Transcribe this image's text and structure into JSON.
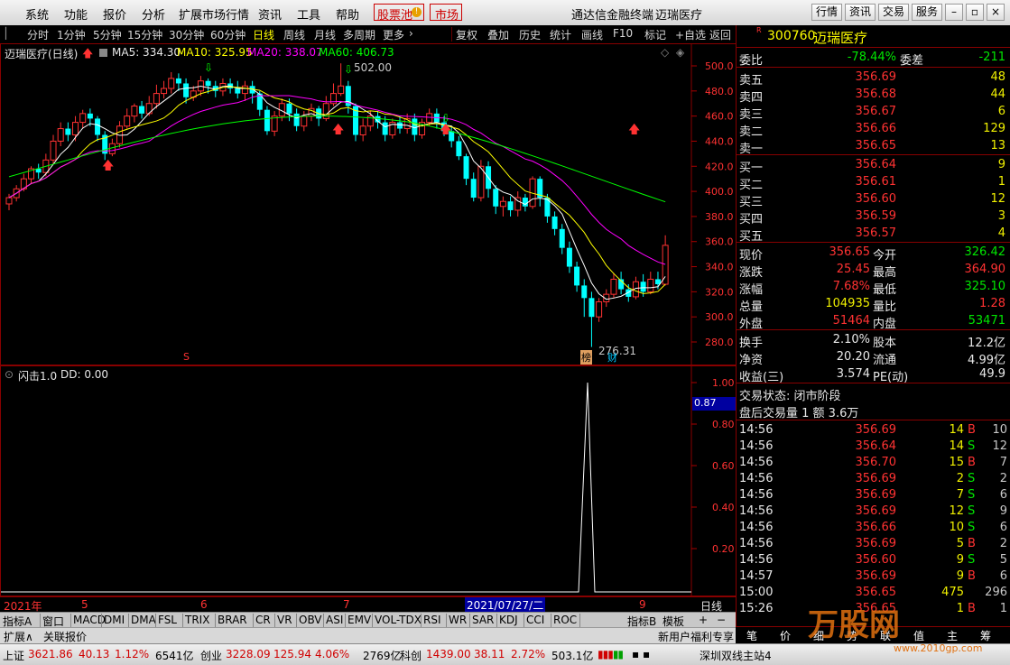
{
  "menu": {
    "items": [
      "系统",
      "功能",
      "报价",
      "分析",
      "扩展市场行情",
      "资讯",
      "工具",
      "帮助"
    ],
    "stock_pool": "股票池",
    "market": "市场",
    "app_title": "通达信金融终端",
    "stock_title": "迈瑞医疗",
    "right_buttons": [
      "行情",
      "资讯",
      "交易",
      "服务"
    ]
  },
  "toolbar": {
    "periods": [
      "分时",
      "1分钟",
      "5分钟",
      "15分钟",
      "30分钟",
      "60分钟",
      "日线",
      "周线",
      "月线",
      "多周期",
      "更多"
    ],
    "active": "日线",
    "tools": [
      "复权",
      "叠加",
      "历史",
      "统计",
      "画线",
      "F10",
      "标记",
      "+自选",
      "返回"
    ]
  },
  "chart": {
    "header": {
      "name": "迈瑞医疗(日线)",
      "ma5_label": "MA5: 334.30",
      "ma10_label": "MA10: 325.95",
      "ma20_label": "MA20: 338.07",
      "ma60_label": "MA60: 406.73"
    },
    "colors": {
      "up": "#ff3232",
      "down": "#00ffff",
      "ma5": "#ffffff",
      "ma10": "#ffff00",
      "ma20": "#ff00ff",
      "ma60": "#00ff00"
    },
    "yticks": [
      "500.0",
      "480.0",
      "460.0",
      "440.0",
      "420.0",
      "400.0",
      "380.0",
      "360.0",
      "340.0",
      "320.0",
      "300.0",
      "280.0"
    ],
    "high_marker": "502.00",
    "low_marker": "276.31",
    "badges": [
      "榜",
      "财"
    ],
    "s_marker": "S"
  },
  "indicator": {
    "name": "闪击1.0",
    "dd_label": "DD: 0.00",
    "yticks": [
      "1.00",
      "0.80",
      "0.60",
      "0.40",
      "0.20"
    ],
    "current": "0.87"
  },
  "xaxis": {
    "labels": [
      "2021年",
      "5",
      "6",
      "7",
      "9"
    ],
    "cursor": "2021/07/27/二",
    "period": "日线"
  },
  "indicator_tabs": [
    "指标A",
    "窗口",
    "MACD",
    "DMI",
    "DMA",
    "FSL",
    "TRIX",
    "BRAR",
    "CR",
    "VR",
    "OBV",
    "ASI",
    "EMV",
    "VOL-TDX",
    "RSI",
    "WR",
    "SAR",
    "KDJ",
    "CCI",
    "ROC"
  ],
  "indicator_tabs_right": [
    "指标B",
    "模",
    "板"
  ],
  "bottom_row": {
    "expand": "扩展∧",
    "link": "关联报价",
    "promo": "新用户福利专享"
  },
  "quote": {
    "code": "300760",
    "name": "迈瑞医疗",
    "weibi_label": "委比",
    "weibi": "-78.44%",
    "weicha_label": "委差",
    "weicha": "-211",
    "asks": [
      {
        "label": "卖五",
        "price": "356.69",
        "vol": "48"
      },
      {
        "label": "卖四",
        "price": "356.68",
        "vol": "44"
      },
      {
        "label": "卖三",
        "price": "356.67",
        "vol": "6"
      },
      {
        "label": "卖二",
        "price": "356.66",
        "vol": "129"
      },
      {
        "label": "卖一",
        "price": "356.65",
        "vol": "13"
      }
    ],
    "bids": [
      {
        "label": "买一",
        "price": "356.64",
        "vol": "9"
      },
      {
        "label": "买二",
        "price": "356.61",
        "vol": "1"
      },
      {
        "label": "买三",
        "price": "356.60",
        "vol": "12"
      },
      {
        "label": "买四",
        "price": "356.59",
        "vol": "3"
      },
      {
        "label": "买五",
        "price": "356.57",
        "vol": "4"
      }
    ],
    "stats": [
      {
        "l1": "现价",
        "v1": "356.65",
        "l2": "今开",
        "v2": "326.42",
        "c1": "c-red",
        "c2": "c-green"
      },
      {
        "l1": "涨跌",
        "v1": "25.45",
        "l2": "最高",
        "v2": "364.90",
        "c1": "c-red",
        "c2": "c-red"
      },
      {
        "l1": "涨幅",
        "v1": "7.68%",
        "l2": "最低",
        "v2": "325.10",
        "c1": "c-red",
        "c2": "c-green"
      },
      {
        "l1": "总量",
        "v1": "104935",
        "l2": "量比",
        "v2": "1.28",
        "c1": "c-yel",
        "c2": "c-red"
      },
      {
        "l1": "外盘",
        "v1": "51464",
        "l2": "内盘",
        "v2": "53471",
        "c1": "c-red",
        "c2": "c-green"
      }
    ],
    "stats2": [
      {
        "l1": "换手",
        "v1": "2.10%",
        "l2": "股本",
        "v2": "12.2亿"
      },
      {
        "l1": "净资",
        "v1": "20.20",
        "l2": "流通",
        "v2": "4.99亿"
      },
      {
        "l1": "收益(三)",
        "v1": "3.574",
        "l2": "PE(动)",
        "v2": "49.9"
      }
    ],
    "trade_status": "交易状态: 闭市阶段",
    "after_hours": "盘后交易量 1 额 3.6万",
    "ticks": [
      {
        "t": "14:56",
        "p": "356.69",
        "v": "14",
        "bs": "B",
        "n": "10"
      },
      {
        "t": "14:56",
        "p": "356.64",
        "v": "14",
        "bs": "S",
        "n": "12"
      },
      {
        "t": "14:56",
        "p": "356.70",
        "v": "15",
        "bs": "B",
        "n": "7"
      },
      {
        "t": "14:56",
        "p": "356.69",
        "v": "2",
        "bs": "S",
        "n": "2"
      },
      {
        "t": "14:56",
        "p": "356.69",
        "v": "7",
        "bs": "S",
        "n": "6"
      },
      {
        "t": "14:56",
        "p": "356.69",
        "v": "12",
        "bs": "S",
        "n": "9"
      },
      {
        "t": "14:56",
        "p": "356.66",
        "v": "10",
        "bs": "S",
        "n": "6"
      },
      {
        "t": "14:56",
        "p": "356.69",
        "v": "5",
        "bs": "B",
        "n": "2"
      },
      {
        "t": "14:56",
        "p": "356.60",
        "v": "9",
        "bs": "S",
        "n": "5"
      },
      {
        "t": "14:57",
        "p": "356.69",
        "v": "9",
        "bs": "B",
        "n": "6"
      },
      {
        "t": "15:00",
        "p": "356.65",
        "v": "475",
        "bs": "",
        "n": "296"
      },
      {
        "t": "15:26",
        "p": "356.65",
        "v": "1",
        "bs": "B",
        "n": "1"
      }
    ],
    "tabs": [
      "笔",
      "价",
      "细",
      "势",
      "联",
      "值",
      "主",
      "筹"
    ]
  },
  "status": {
    "sh_label": "上证",
    "sh": "3621.86",
    "sh_chg": "40.13",
    "sh_pct": "1.12%",
    "sh_amt": "6541亿",
    "cy_label": "创业",
    "cy": "3228.09",
    "cy_chg": "125.94",
    "cy_pct": "4.06%",
    "cy_amt": "2769亿",
    "kc_label": "科创",
    "kc": "1439.00",
    "kc_chg": "38.11",
    "kc_pct": "2.72%",
    "kc_amt": "503.1亿",
    "server": "深圳双线主站4"
  },
  "watermark": {
    "text": "万股网",
    "url": "www.2010gp.com"
  }
}
